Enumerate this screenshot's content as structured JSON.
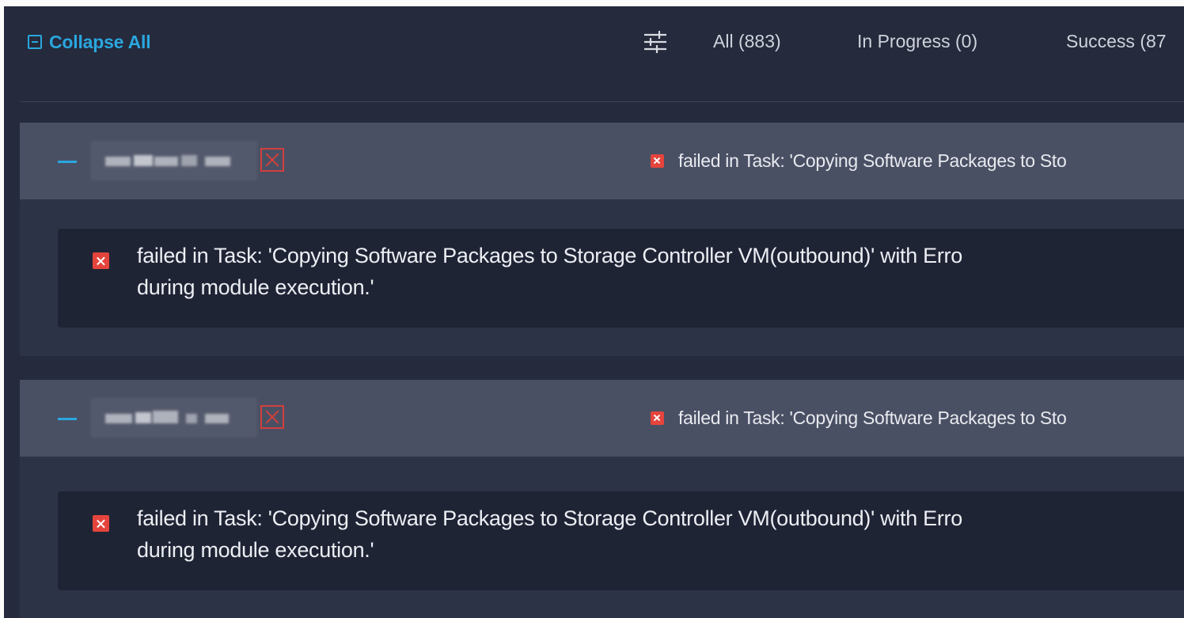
{
  "toolbar": {
    "collapse_all_label": "Collapse All",
    "filter_icon": "filter-sliders-icon",
    "tabs": [
      {
        "label": "All (883)"
      },
      {
        "label": "In Progress (0)"
      },
      {
        "label": "Success (87"
      }
    ]
  },
  "groups": [
    {
      "status_icon": "failed-box-icon",
      "header_message": "failed in Task: 'Copying Software Packages to Sto",
      "detail_message_line1": "failed in Task: 'Copying Software Packages to Storage Controller VM(outbound)' with Erro",
      "detail_message_line2": "during module execution.'"
    },
    {
      "status_icon": "failed-box-icon",
      "header_message": "failed in Task: 'Copying Software Packages to Sto",
      "detail_message_line1": "failed in Task: 'Copying Software Packages to Storage Controller VM(outbound)' with Erro",
      "detail_message_line2": "during module execution.'"
    }
  ],
  "colors": {
    "accent": "#2aa7df",
    "error": "#e5443c",
    "background": "#252a3c",
    "group_header": "#4a5064",
    "detail_panel": "#1f2435"
  }
}
